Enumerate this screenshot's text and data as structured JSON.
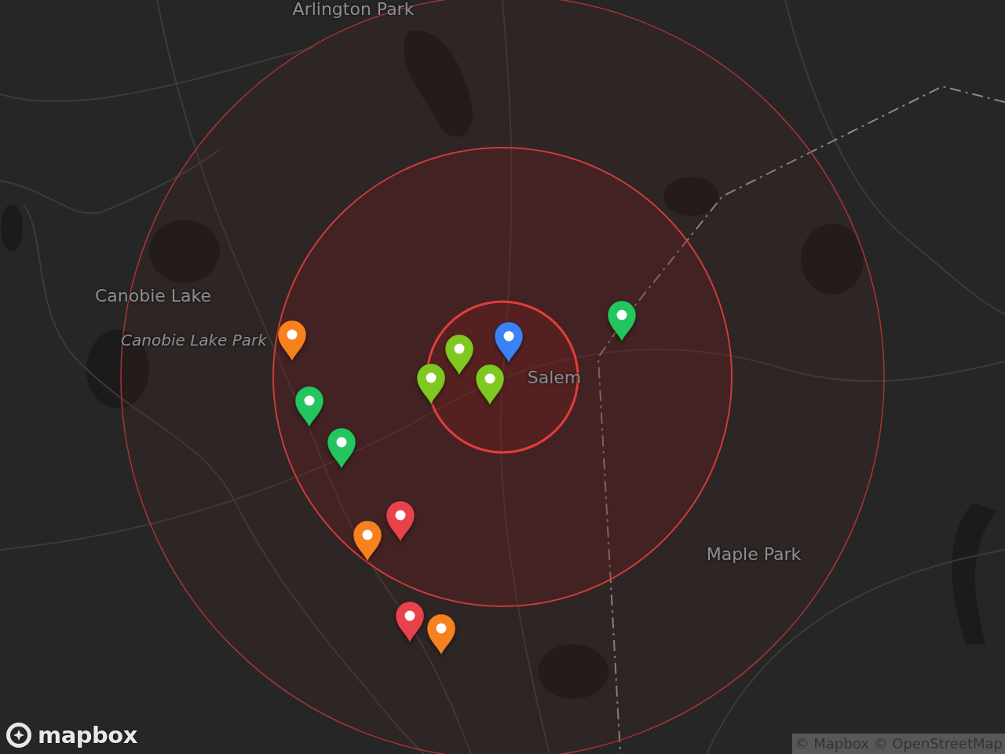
{
  "map": {
    "labels": [
      {
        "text": "Arlington Park",
        "kind": "place"
      },
      {
        "text": "Canobie Lake",
        "kind": "place"
      },
      {
        "text": "Canobie Lake Park",
        "kind": "park"
      },
      {
        "text": "Salem",
        "kind": "place"
      },
      {
        "text": "Maple Park",
        "kind": "place"
      }
    ],
    "pins": [
      {
        "color": "#f5821f"
      },
      {
        "color": "#22c55e"
      },
      {
        "color": "#22c55e"
      },
      {
        "color": "#7ec820"
      },
      {
        "color": "#7ec820"
      },
      {
        "color": "#7ec820"
      },
      {
        "color": "#3b82f6"
      },
      {
        "color": "#22c55e"
      },
      {
        "color": "#e8434b"
      },
      {
        "color": "#f5821f"
      },
      {
        "color": "#e8434b"
      },
      {
        "color": "#f5821f"
      }
    ]
  },
  "logo": {
    "text": "mapbox"
  },
  "attribution": "© Mapbox © OpenStreetMap"
}
